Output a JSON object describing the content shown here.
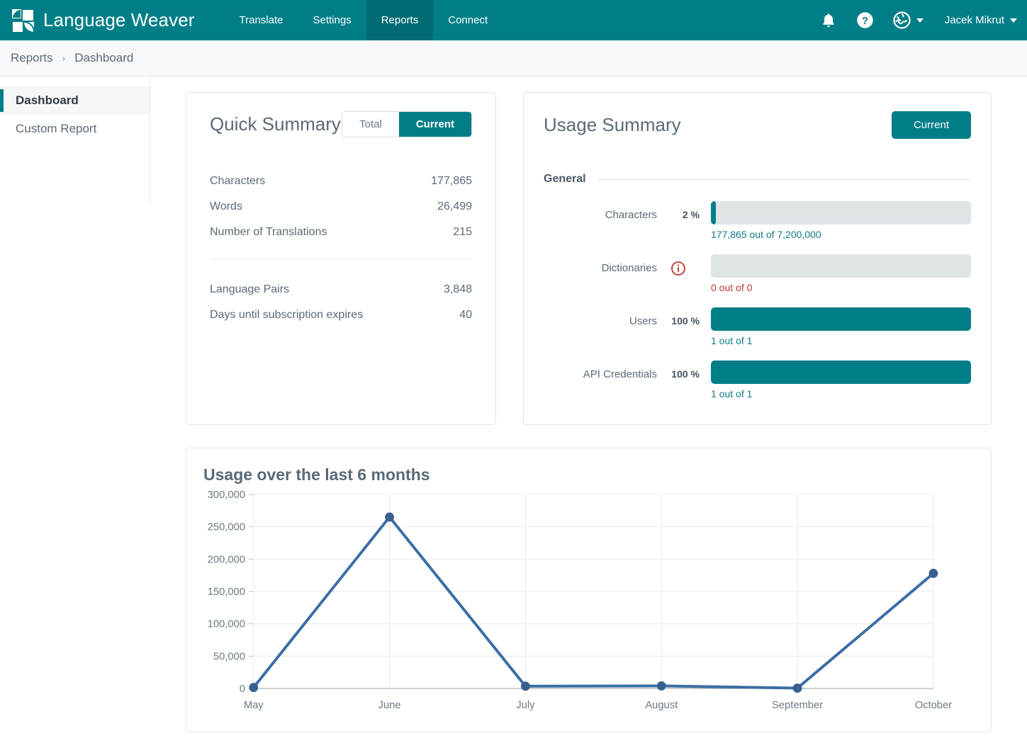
{
  "brand": {
    "name": "Language Weaver",
    "logo_icon": "language-weaver-logo-icon"
  },
  "topnav": {
    "items": [
      {
        "label": "Translate",
        "active": false
      },
      {
        "label": "Settings",
        "active": false
      },
      {
        "label": "Reports",
        "active": true
      },
      {
        "label": "Connect",
        "active": false
      }
    ],
    "notifications_icon": "bell-icon",
    "help_icon": "question-circle-icon",
    "language_icon": "globe-icon",
    "user_name": "Jacek Mikrut",
    "accent_color": "#007E87",
    "accent_active_color": "#006B73"
  },
  "breadcrumb": {
    "parent": "Reports",
    "separator": "›",
    "current": "Dashboard"
  },
  "sidebar": {
    "items": [
      {
        "label": "Dashboard",
        "active": true
      },
      {
        "label": "Custom Report",
        "active": false
      }
    ]
  },
  "quick_summary": {
    "title": "Quick Summary",
    "toggle": {
      "options": [
        "Total",
        "Current"
      ],
      "selected": "Current"
    },
    "rows_primary": [
      {
        "label": "Characters",
        "value": "177,865"
      },
      {
        "label": "Words",
        "value": "26,499"
      },
      {
        "label": "Number of Translations",
        "value": "215"
      }
    ],
    "rows_secondary": [
      {
        "label": "Language Pairs",
        "value": "3,848"
      },
      {
        "label": "Days until subscription expires",
        "value": "40"
      }
    ]
  },
  "usage_summary": {
    "title": "Usage Summary",
    "button_label": "Current",
    "section_label": "General",
    "rows": [
      {
        "label": "Characters",
        "percent_label": "2 %",
        "percent_value": 2,
        "caption": "177,865 out of 7,200,000",
        "caption_state": "normal",
        "has_info_icon": false
      },
      {
        "label": "Dictionaries",
        "percent_label": "",
        "percent_value": 0,
        "caption": "0 out of 0",
        "caption_state": "danger",
        "has_info_icon": true,
        "info_icon": "info-circle-icon"
      },
      {
        "label": "Users",
        "percent_label": "100 %",
        "percent_value": 100,
        "caption": "1 out of 1",
        "caption_state": "normal",
        "has_info_icon": false
      },
      {
        "label": "API Credentials",
        "percent_label": "100 %",
        "percent_value": 100,
        "caption": "1 out of 1",
        "caption_state": "normal",
        "has_info_icon": false
      }
    ],
    "bar_fill_color": "#007E87",
    "bar_track_color": "#dfe4e7",
    "danger_color": "#c0392b"
  },
  "chart_data": {
    "type": "line",
    "title": "Usage over the last 6 months",
    "categories": [
      "May",
      "June",
      "July",
      "August",
      "September",
      "October"
    ],
    "values": [
      1500,
      265000,
      3500,
      4000,
      500,
      177865
    ],
    "series": [
      {
        "name": "Characters",
        "values": [
          1500,
          265000,
          3500,
          4000,
          500,
          177865
        ]
      }
    ],
    "xlabel": "",
    "ylabel": "",
    "ylim": [
      0,
      300000
    ],
    "yticks": [
      0,
      50000,
      100000,
      150000,
      200000,
      250000,
      300000
    ],
    "ytick_labels": [
      "0",
      "50,000",
      "100,000",
      "150,000",
      "200,000",
      "250,000",
      "300,000"
    ],
    "grid": true,
    "legend": "none",
    "line_color": "#3b6ea5",
    "marker_color": "#36618f"
  }
}
